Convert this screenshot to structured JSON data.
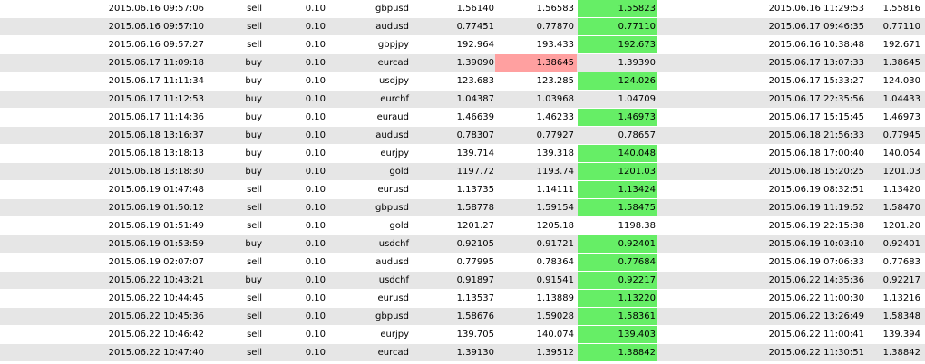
{
  "colors": {
    "row_alt": "#e6e6e6",
    "take_profit_hit": "#66ee66",
    "stop_loss_hit": "#ffa0a0"
  },
  "trades": [
    {
      "open_time": "2015.06.16 09:57:06",
      "type": "sell",
      "size": "0.10",
      "item": "gbpusd",
      "price": "1.56140",
      "sl": "1.56583",
      "tp": "1.55823",
      "close_time": "2015.06.16 11:29:53",
      "close_price": "1.55816",
      "hit": "tp"
    },
    {
      "open_time": "2015.06.16 09:57:10",
      "type": "sell",
      "size": "0.10",
      "item": "audusd",
      "price": "0.77451",
      "sl": "0.77870",
      "tp": "0.77110",
      "close_time": "2015.06.17 09:46:35",
      "close_price": "0.77110",
      "hit": "tp"
    },
    {
      "open_time": "2015.06.16 09:57:27",
      "type": "sell",
      "size": "0.10",
      "item": "gbpjpy",
      "price": "192.964",
      "sl": "193.433",
      "tp": "192.673",
      "close_time": "2015.06.16 10:38:48",
      "close_price": "192.671",
      "hit": "tp"
    },
    {
      "open_time": "2015.06.17 11:09:18",
      "type": "buy",
      "size": "0.10",
      "item": "eurcad",
      "price": "1.39090",
      "sl": "1.38645",
      "tp": "1.39390",
      "close_time": "2015.06.17 13:07:33",
      "close_price": "1.38645",
      "hit": "sl"
    },
    {
      "open_time": "2015.06.17 11:11:34",
      "type": "buy",
      "size": "0.10",
      "item": "usdjpy",
      "price": "123.683",
      "sl": "123.285",
      "tp": "124.026",
      "close_time": "2015.06.17 15:33:27",
      "close_price": "124.030",
      "hit": "tp"
    },
    {
      "open_time": "2015.06.17 11:12:53",
      "type": "buy",
      "size": "0.10",
      "item": "eurchf",
      "price": "1.04387",
      "sl": "1.03968",
      "tp": "1.04709",
      "close_time": "2015.06.17 22:35:56",
      "close_price": "1.04433",
      "hit": ""
    },
    {
      "open_time": "2015.06.17 11:14:36",
      "type": "buy",
      "size": "0.10",
      "item": "euraud",
      "price": "1.46639",
      "sl": "1.46233",
      "tp": "1.46973",
      "close_time": "2015.06.17 15:15:45",
      "close_price": "1.46973",
      "hit": "tp"
    },
    {
      "open_time": "2015.06.18 13:16:37",
      "type": "buy",
      "size": "0.10",
      "item": "audusd",
      "price": "0.78307",
      "sl": "0.77927",
      "tp": "0.78657",
      "close_time": "2015.06.18 21:56:33",
      "close_price": "0.77945",
      "hit": ""
    },
    {
      "open_time": "2015.06.18 13:18:13",
      "type": "buy",
      "size": "0.10",
      "item": "eurjpy",
      "price": "139.714",
      "sl": "139.318",
      "tp": "140.048",
      "close_time": "2015.06.18 17:00:40",
      "close_price": "140.054",
      "hit": "tp"
    },
    {
      "open_time": "2015.06.18 13:18:30",
      "type": "buy",
      "size": "0.10",
      "item": "gold",
      "price": "1197.72",
      "sl": "1193.74",
      "tp": "1201.03",
      "close_time": "2015.06.18 15:20:25",
      "close_price": "1201.03",
      "hit": "tp"
    },
    {
      "open_time": "2015.06.19 01:47:48",
      "type": "sell",
      "size": "0.10",
      "item": "eurusd",
      "price": "1.13735",
      "sl": "1.14111",
      "tp": "1.13424",
      "close_time": "2015.06.19 08:32:51",
      "close_price": "1.13420",
      "hit": "tp"
    },
    {
      "open_time": "2015.06.19 01:50:12",
      "type": "sell",
      "size": "0.10",
      "item": "gbpusd",
      "price": "1.58778",
      "sl": "1.59154",
      "tp": "1.58475",
      "close_time": "2015.06.19 11:19:52",
      "close_price": "1.58470",
      "hit": "tp"
    },
    {
      "open_time": "2015.06.19 01:51:49",
      "type": "sell",
      "size": "0.10",
      "item": "gold",
      "price": "1201.27",
      "sl": "1205.18",
      "tp": "1198.38",
      "close_time": "2015.06.19 22:15:38",
      "close_price": "1201.20",
      "hit": ""
    },
    {
      "open_time": "2015.06.19 01:53:59",
      "type": "buy",
      "size": "0.10",
      "item": "usdchf",
      "price": "0.92105",
      "sl": "0.91721",
      "tp": "0.92401",
      "close_time": "2015.06.19 10:03:10",
      "close_price": "0.92401",
      "hit": "tp"
    },
    {
      "open_time": "2015.06.19 02:07:07",
      "type": "sell",
      "size": "0.10",
      "item": "audusd",
      "price": "0.77995",
      "sl": "0.78364",
      "tp": "0.77684",
      "close_time": "2015.06.19 07:06:33",
      "close_price": "0.77683",
      "hit": "tp"
    },
    {
      "open_time": "2015.06.22 10:43:21",
      "type": "buy",
      "size": "0.10",
      "item": "usdchf",
      "price": "0.91897",
      "sl": "0.91541",
      "tp": "0.92217",
      "close_time": "2015.06.22 14:35:36",
      "close_price": "0.92217",
      "hit": "tp"
    },
    {
      "open_time": "2015.06.22 10:44:45",
      "type": "sell",
      "size": "0.10",
      "item": "eurusd",
      "price": "1.13537",
      "sl": "1.13889",
      "tp": "1.13220",
      "close_time": "2015.06.22 11:00:30",
      "close_price": "1.13216",
      "hit": "tp"
    },
    {
      "open_time": "2015.06.22 10:45:36",
      "type": "sell",
      "size": "0.10",
      "item": "gbpusd",
      "price": "1.58676",
      "sl": "1.59028",
      "tp": "1.58361",
      "close_time": "2015.06.22 13:26:49",
      "close_price": "1.58348",
      "hit": "tp"
    },
    {
      "open_time": "2015.06.22 10:46:42",
      "type": "sell",
      "size": "0.10",
      "item": "eurjpy",
      "price": "139.705",
      "sl": "140.074",
      "tp": "139.403",
      "close_time": "2015.06.22 11:00:41",
      "close_price": "139.394",
      "hit": "tp"
    },
    {
      "open_time": "2015.06.22 10:47:40",
      "type": "sell",
      "size": "0.10",
      "item": "eurcad",
      "price": "1.39130",
      "sl": "1.39512",
      "tp": "1.38842",
      "close_time": "2015.06.22 11:30:51",
      "close_price": "1.38842",
      "hit": "tp"
    }
  ]
}
